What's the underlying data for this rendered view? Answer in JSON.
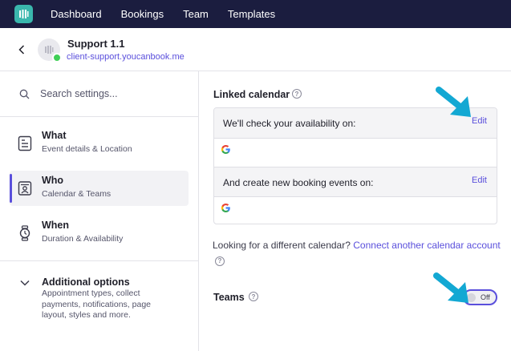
{
  "nav": {
    "items": [
      "Dashboard",
      "Bookings",
      "Team",
      "Templates"
    ]
  },
  "header": {
    "title": "Support 1.1",
    "url": "client-support.youcanbook.me"
  },
  "sidebar": {
    "search_placeholder": "Search settings...",
    "items": [
      {
        "title": "What",
        "desc": "Event details & Location",
        "icon": "document-icon"
      },
      {
        "title": "Who",
        "desc": "Calendar & Teams",
        "icon": "contact-card-icon"
      },
      {
        "title": "When",
        "desc": "Duration & Availability",
        "icon": "watch-icon"
      }
    ],
    "additional": {
      "title": "Additional options",
      "desc": "Appointment types, collect payments, notifications, page layout, styles and more."
    }
  },
  "main": {
    "linked_calendar_label": "Linked calendar",
    "check_text": "We'll check your availability on:",
    "create_text": "And create new booking events on:",
    "edit_label": "Edit",
    "alt_text": "Looking for a different calendar?",
    "alt_link": "Connect another calendar account",
    "teams_label": "Teams",
    "toggle_label": "Off"
  },
  "colors": {
    "nav_bg": "#1b1d3f",
    "accent": "#5a4fdc",
    "logo": "#3ab7ad",
    "status_online": "#3fcf56",
    "annotation_arrow": "#13a8d3"
  }
}
